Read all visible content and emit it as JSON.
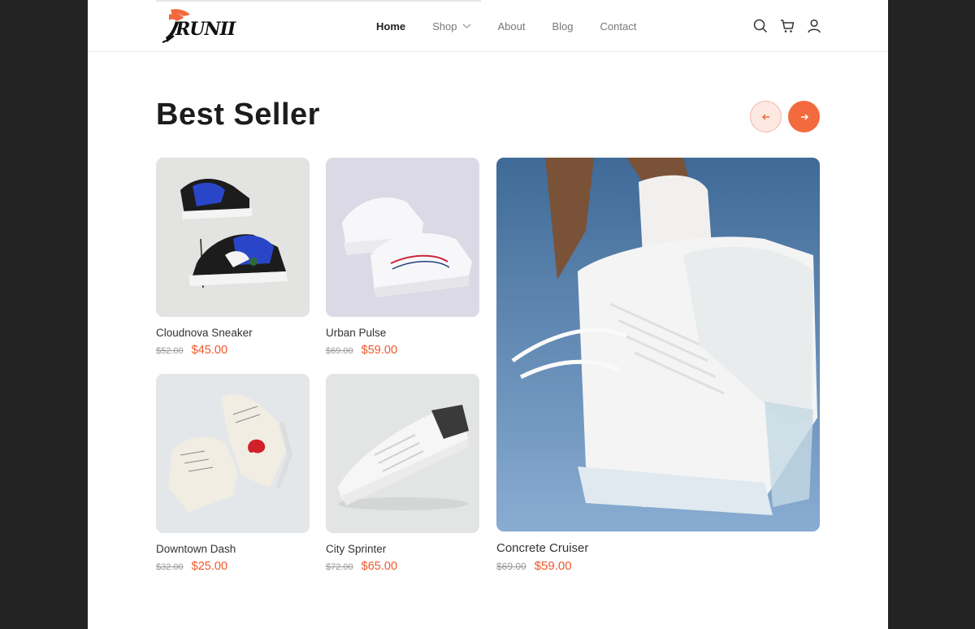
{
  "brand": {
    "logo_text": "RUNII",
    "accent": "#f26a3d"
  },
  "nav": {
    "items": [
      {
        "label": "Home",
        "active": true
      },
      {
        "label": "Shop",
        "dropdown": true
      },
      {
        "label": "About"
      },
      {
        "label": "Blog"
      },
      {
        "label": "Contact"
      }
    ]
  },
  "header_icons": [
    "search-icon",
    "cart-icon",
    "user-icon"
  ],
  "section": {
    "title": "Best Seller"
  },
  "products": [
    {
      "name": "Cloudnova Sneaker",
      "old_price": "$52.00",
      "price": "$45.00"
    },
    {
      "name": "Urban Pulse",
      "old_price": "$69.00",
      "price": "$59.00"
    },
    {
      "name": "Downtown Dash",
      "old_price": "$32.00",
      "price": "$25.00"
    },
    {
      "name": "City Sprinter",
      "old_price": "$72.00",
      "price": "$65.00"
    },
    {
      "name": "Concrete Cruiser",
      "old_price": "$69.00",
      "price": "$59.00"
    }
  ]
}
